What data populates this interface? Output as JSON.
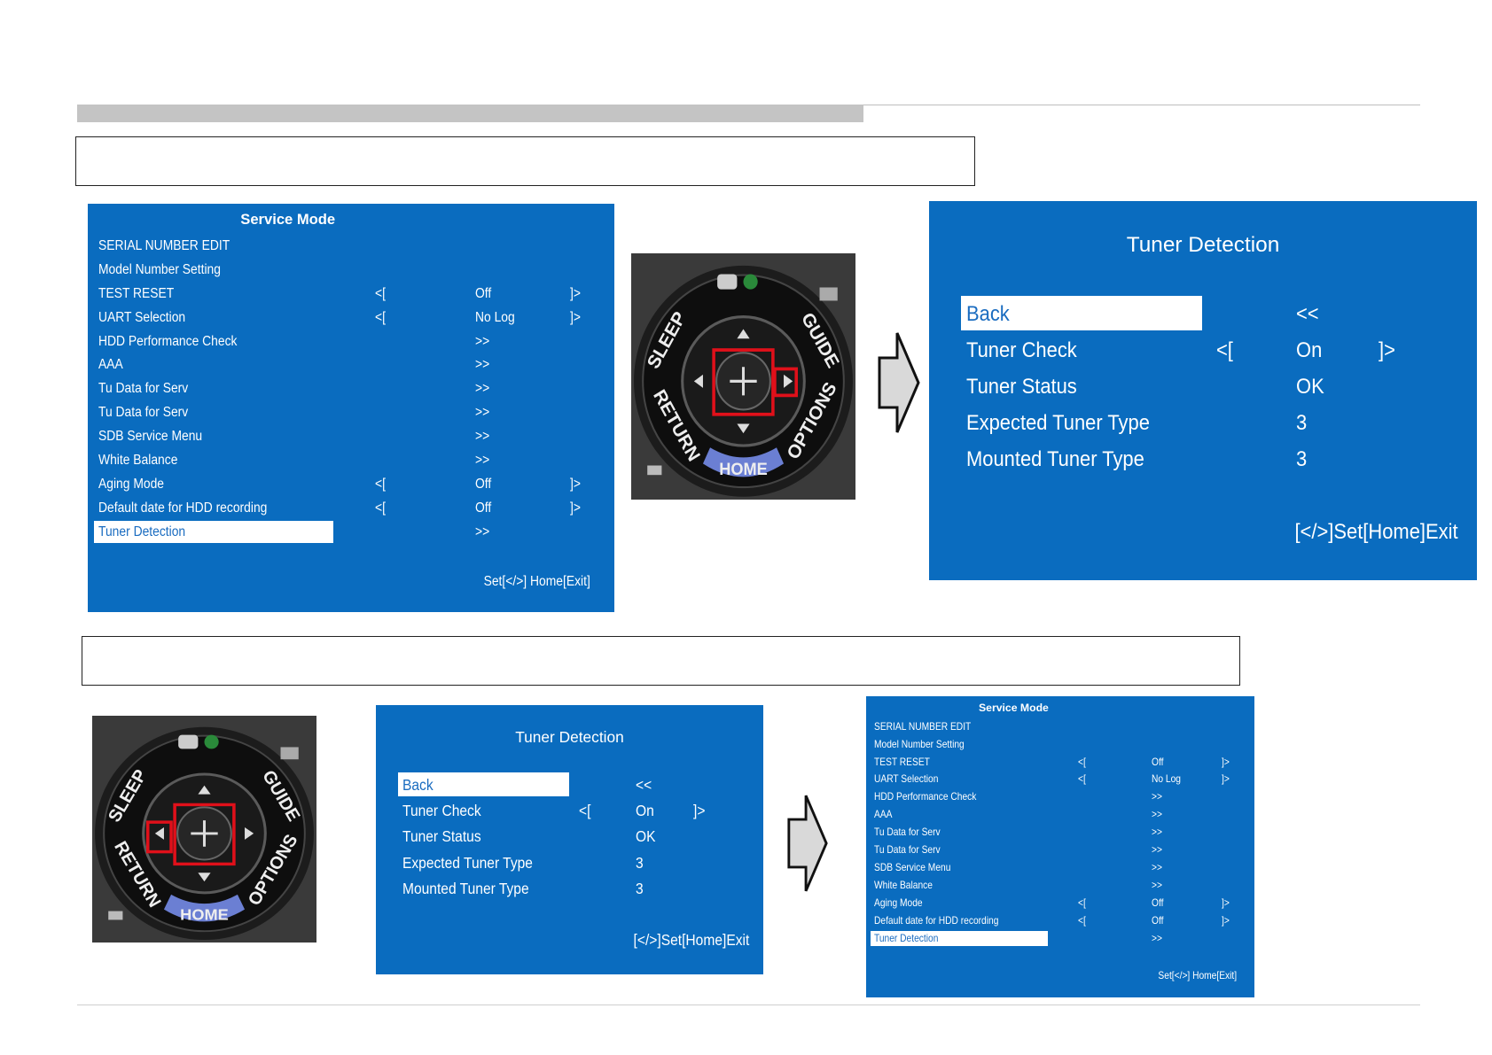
{
  "colors": {
    "screen_bg": "#0a6cbf",
    "highlight": "#ffffff",
    "remote_highlight": "#e0101a"
  },
  "service_menu": {
    "title": "Service Mode",
    "items": [
      {
        "label": "SERIAL NUMBER EDIT",
        "lb": "",
        "val": "",
        "rb": ""
      },
      {
        "label": "Model Number Setting",
        "lb": "",
        "val": "",
        "rb": ""
      },
      {
        "label": "TEST RESET",
        "lb": "<[",
        "val": "Off",
        "rb": "]>"
      },
      {
        "label": "UART Selection",
        "lb": "<[",
        "val": "No Log",
        "rb": "]>"
      },
      {
        "label": "HDD Performance Check",
        "lb": "",
        "val": ">>",
        "rb": ""
      },
      {
        "label": "AAA",
        "lb": "",
        "val": ">>",
        "rb": ""
      },
      {
        "label": "Tu Data for Serv",
        "lb": "",
        "val": ">>",
        "rb": ""
      },
      {
        "label": "Tu Data for Serv",
        "lb": "",
        "val": ">>",
        "rb": ""
      },
      {
        "label": "SDB Service Menu",
        "lb": "",
        "val": ">>",
        "rb": ""
      },
      {
        "label": "White Balance",
        "lb": "",
        "val": ">>",
        "rb": ""
      },
      {
        "label": "Aging Mode",
        "lb": "<[",
        "val": "Off",
        "rb": "]>"
      },
      {
        "label": "Default date for HDD recording",
        "lb": "<[",
        "val": "Off",
        "rb": "]>"
      },
      {
        "label": "Tuner Detection",
        "lb": "",
        "val": ">>",
        "rb": ""
      }
    ],
    "footer": "Set[</>] Home[Exit]"
  },
  "tuner_detection": {
    "title": "Tuner Detection",
    "items": [
      {
        "label": "Back",
        "lb": "",
        "val": "<<",
        "rb": ""
      },
      {
        "label": "Tuner Check",
        "lb": "<[",
        "val": "On",
        "rb": "]>"
      },
      {
        "label": "Tuner Status",
        "lb": "",
        "val": "OK",
        "rb": ""
      },
      {
        "label": "Expected Tuner Type",
        "lb": "",
        "val": "3",
        "rb": ""
      },
      {
        "label": "Mounted Tuner Type",
        "lb": "",
        "val": "3",
        "rb": ""
      }
    ],
    "footer": "[</>]Set[Home]Exit"
  },
  "remote": {
    "buttons": {
      "sleep": "SLEEP",
      "guide": "GUIDE",
      "return": "RETURN",
      "options": "OPTIONS",
      "home": "HOME"
    },
    "icons": [
      "input-icon",
      "help-icon",
      "teletext-icon",
      "back-icon"
    ]
  }
}
